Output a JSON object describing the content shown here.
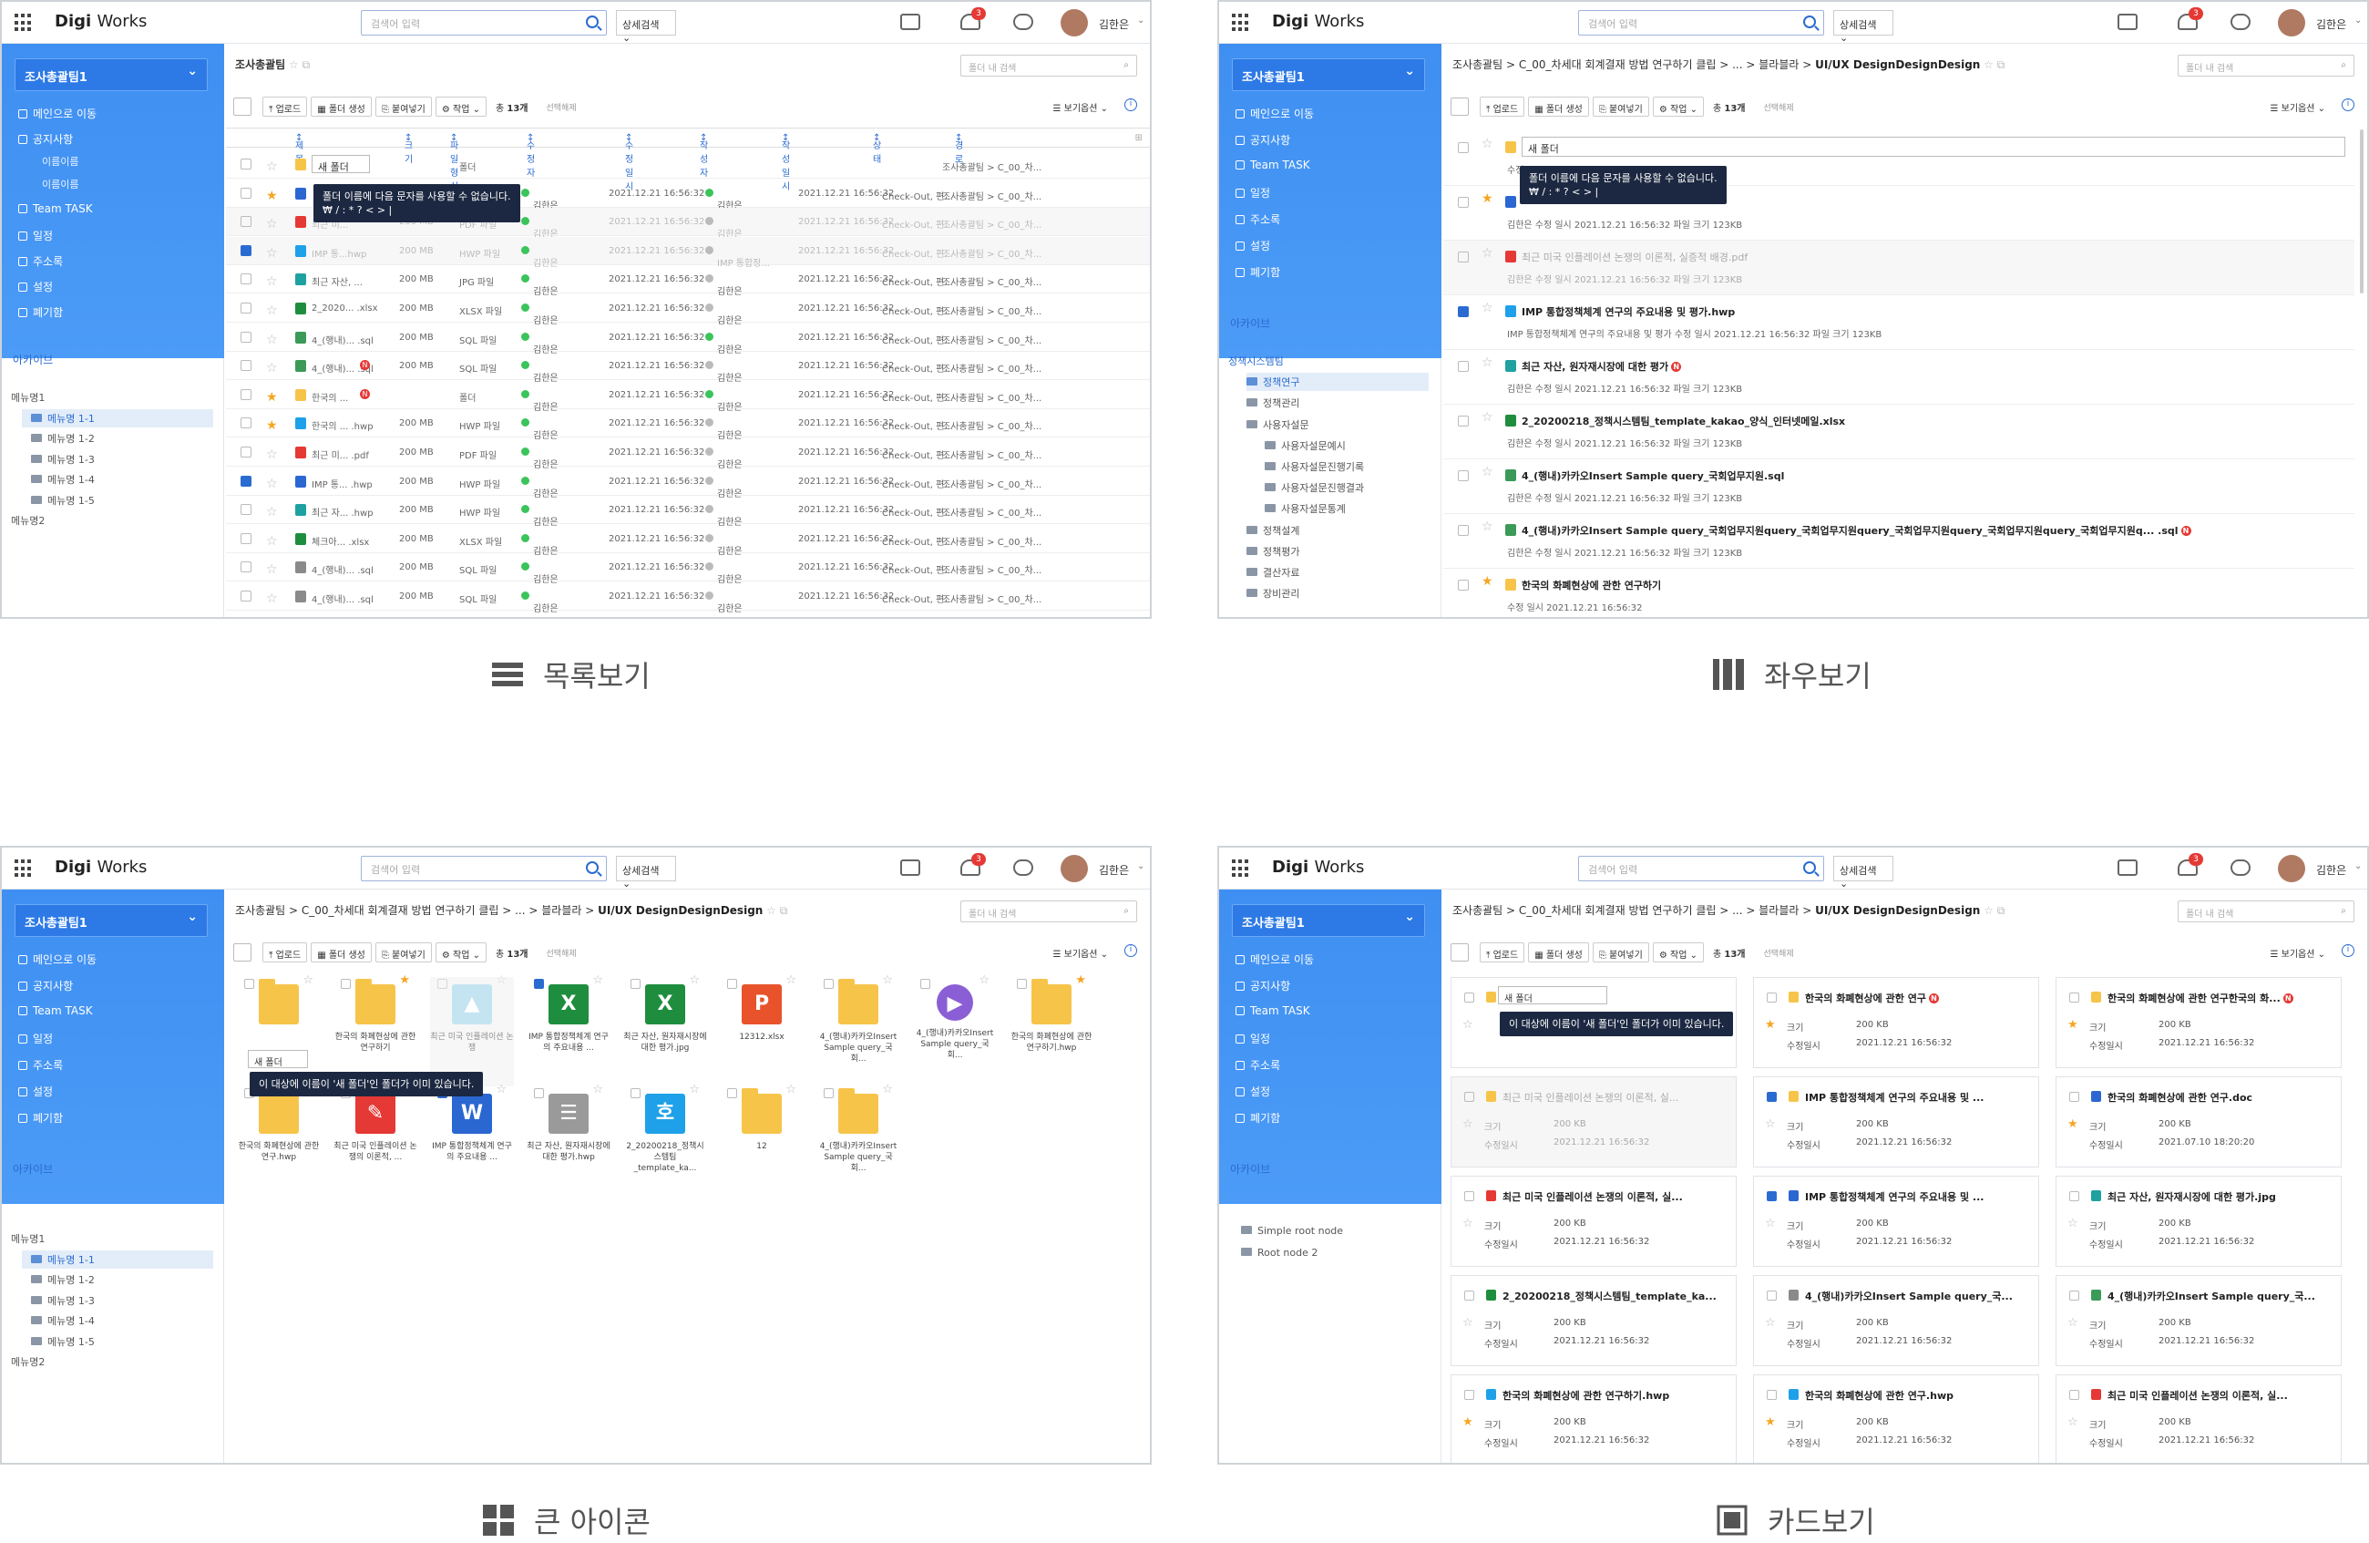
{
  "app": {
    "logo_bold": "Digi",
    "logo_rest": "Works",
    "search_placeholder": "검색어 입력",
    "adv_search": "상세검색",
    "badge": "3",
    "user": "김한은"
  },
  "sidebar": {
    "team": "조사총괄팀1",
    "nav": [
      "메인으로 이동",
      "공지사항",
      "Team TASK",
      "일정",
      "주소록",
      "설정",
      "폐기함"
    ],
    "notice_sub": [
      "이름이름",
      "이름이름"
    ],
    "archive": "아카이브"
  },
  "tree_menu": [
    "메뉴명1",
    "메뉴명 1-1",
    "메뉴명 1-2",
    "메뉴명 1-3",
    "메뉴명 1-4",
    "메뉴명 1-5",
    "메뉴명2"
  ],
  "tree_policy": [
    "정책시스템팀",
    "정책연구",
    "정책관리",
    "사용자설문",
    "사용자설문예시",
    "사용자설문진행기록",
    "사용자설문진행결과",
    "사용자설문통계",
    "정책설계",
    "정책평가",
    "결산자료",
    "장비관리"
  ],
  "tree_root": [
    "Simple root node",
    "Root node 2"
  ],
  "toolbar": {
    "upload": "업로드",
    "new_folder": "폴더 생성",
    "paste": "붙여넣기",
    "work": "작업",
    "count_prefix": "총",
    "count": "13개",
    "selected": "선택해제",
    "view_opt": "보기옵션",
    "folder_search": "폴더 내 검색"
  },
  "bc_short": "조사총괄팀",
  "bc_long": [
    "조사총괄팀",
    "C_00_차세대 회계결재 방법 연구하기 클립",
    "...",
    "블라블라",
    "UI/UX DesignDesignDesign"
  ],
  "list_view": {
    "headers": [
      "제목",
      "크기",
      "파일 형식",
      "수정자",
      "수정 일시",
      "작성자",
      "작성 일시",
      "상태",
      "경로"
    ],
    "new_folder_value": "새 폴더",
    "tooltip": [
      "폴더 이름에 다음 문자를 사용할 수 없습니다.",
      "₩ / : * ? < > |"
    ],
    "rows": [
      {
        "name": "",
        "size": "",
        "type": "폴더",
        "mod": "",
        "date": "",
        "author": "",
        "cdate": "",
        "state": "",
        "path": "조사총괄팀 > C_00_차...",
        "icon": "folder",
        "star": false,
        "cb": false,
        "dim": false,
        "gray": false
      },
      {
        "name": "",
        "size": "",
        "type": "",
        "mod": "김한은",
        "date": "2021.12.21 16:56:32",
        "author": "김한은",
        "cdate": "2021.12.21 16:56:32",
        "state": "Check-Out, 편...",
        "path": "조사총괄팀 > C_00_차...",
        "icon": "word",
        "star": true,
        "cb": false,
        "dim": false,
        "gray": false
      },
      {
        "name": "최근 미...",
        "size": "200 MB",
        "type": "PDF 파일",
        "mod": "김한은",
        "date": "2021.12.21 16:56:32",
        "author": "김한은",
        "cdate": "2021.12.21 16:56:32",
        "state": "Check-Out, 편...",
        "path": "조사총괄팀 > C_00_차...",
        "icon": "pdf",
        "star": false,
        "cb": false,
        "dim": true,
        "gray": true
      },
      {
        "name": "IMP 통...hwp",
        "size": "200 MB",
        "type": "HWP 파일",
        "mod": "김한은",
        "date": "2021.12.21 16:56:32",
        "author": "IMP 통합정...",
        "cdate": "2021.12.21 16:56:32",
        "state": "Check-Out, 편...",
        "path": "조사총괄팀 > C_00_차...",
        "icon": "hwp",
        "star": false,
        "cb": true,
        "dim": true,
        "gray": true
      },
      {
        "name": "최근 자산, ...",
        "size": "200 MB",
        "type": "JPG 파일",
        "mod": "김한은",
        "date": "2021.12.21 16:56:32",
        "author": "김한은",
        "cdate": "2021.12.21 16:56:32",
        "state": "Check-Out, 편...",
        "path": "조사총괄팀 > C_00_차...",
        "icon": "jpg",
        "star": false,
        "cb": false,
        "dim": false,
        "gray": true
      },
      {
        "name": "2_2020... .xlsx",
        "size": "200 MB",
        "type": "XLSX 파일",
        "mod": "김한은",
        "date": "2021.12.21 16:56:32",
        "author": "김한은",
        "cdate": "2021.12.21 16:56:32",
        "state": "Check-Out, 편...",
        "path": "조사총괄팀 > C_00_차...",
        "icon": "xlsx",
        "star": false,
        "cb": false,
        "dim": false,
        "gray": true
      },
      {
        "name": "4_(행내)... .sql",
        "size": "200 MB",
        "type": "SQL 파일",
        "mod": "김한은",
        "date": "2021.12.21 16:56:32",
        "author": "김한은",
        "cdate": "2021.12.21 16:56:32",
        "state": "Check-Out, 편...",
        "path": "조사총괄팀 > C_00_차...",
        "icon": "sql",
        "star": false,
        "cb": false,
        "dim": false,
        "gray": false
      },
      {
        "name": "4_(행내)... .sql",
        "size": "200 MB",
        "type": "SQL 파일",
        "mod": "김한은",
        "date": "2021.12.21 16:56:32",
        "author": "김한은",
        "cdate": "2021.12.21 16:56:32",
        "state": "Check-Out, 편...",
        "path": "조사총괄팀 > C_00_차...",
        "icon": "sql",
        "star": false,
        "cb": false,
        "dim": false,
        "gray": true,
        "n": true
      },
      {
        "name": "한국의 ...",
        "size": "",
        "type": "폴더",
        "mod": "김한은",
        "date": "2021.12.21 16:56:32",
        "author": "김한은",
        "cdate": "2021.12.21 16:56:32",
        "state": "Check-Out, 편...",
        "path": "조사총괄팀 > C_00_차...",
        "icon": "folder",
        "star": true,
        "cb": false,
        "dim": false,
        "gray": false,
        "n": true
      },
      {
        "name": "한국의 ... .hwp",
        "size": "200 MB",
        "type": "HWP 파일",
        "mod": "김한은",
        "date": "2021.12.21 16:56:32",
        "author": "김한은",
        "cdate": "2021.12.21 16:56:32",
        "state": "Check-Out, 편...",
        "path": "조사총괄팀 > C_00_차...",
        "icon": "hwp",
        "star": true,
        "cb": false,
        "dim": false,
        "gray": true
      },
      {
        "name": "최근 미... .pdf",
        "size": "200 MB",
        "type": "PDF 파일",
        "mod": "김한은",
        "date": "2021.12.21 16:56:32",
        "author": "김한은",
        "cdate": "2021.12.21 16:56:32",
        "state": "Check-Out, 편...",
        "path": "조사총괄팀 > C_00_차...",
        "icon": "pdf",
        "star": false,
        "cb": false,
        "dim": false,
        "gray": true
      },
      {
        "name": "IMP 통... .hwp",
        "size": "200 MB",
        "type": "HWP 파일",
        "mod": "김한은",
        "date": "2021.12.21 16:56:32",
        "author": "김한은",
        "cdate": "2021.12.21 16:56:32",
        "state": "Check-Out, 편...",
        "path": "조사총괄팀 > C_00_차...",
        "icon": "word",
        "star": false,
        "cb": true,
        "dim": false,
        "gray": true
      },
      {
        "name": "최근 자... .hwp",
        "size": "200 MB",
        "type": "HWP 파일",
        "mod": "김한은",
        "date": "2021.12.21 16:56:32",
        "author": "김한은",
        "cdate": "2021.12.21 16:56:32",
        "state": "Check-Out, 편...",
        "path": "조사총괄팀 > C_00_차...",
        "icon": "jpg",
        "star": false,
        "cb": false,
        "dim": false,
        "gray": true
      },
      {
        "name": "체크아... .xlsx",
        "size": "200 MB",
        "type": "XLSX 파일",
        "mod": "김한은",
        "date": "2021.12.21 16:56:32",
        "author": "김한은",
        "cdate": "2021.12.21 16:56:32",
        "state": "Check-Out, 편...",
        "path": "조사총괄팀 > C_00_차...",
        "icon": "xlsx",
        "star": false,
        "cb": false,
        "dim": false,
        "gray": true
      },
      {
        "name": "4_(행내)... .sql",
        "size": "200 MB",
        "type": "SQL 파일",
        "mod": "김한은",
        "date": "2021.12.21 16:56:32",
        "author": "김한은",
        "cdate": "2021.12.21 16:56:32",
        "state": "Check-Out, 편...",
        "path": "조사총괄팀 > C_00_차...",
        "icon": "sqlg",
        "star": false,
        "cb": false,
        "dim": false,
        "gray": true
      },
      {
        "name": "4_(행내)... .sql",
        "size": "200 MB",
        "type": "SQL 파일",
        "mod": "김한은",
        "date": "2021.12.21 16:56:32",
        "author": "김한은",
        "cdate": "2021.12.21 16:56:32",
        "state": "Check-Out, 편...",
        "path": "조사총괄팀 > C_00_차...",
        "icon": "sqlg",
        "star": false,
        "cb": false,
        "dim": false,
        "gray": true
      }
    ]
  },
  "lr_view": {
    "new_folder_value": "새 폴더",
    "tooltip": [
      "폴더 이름에 다음 문자를 사용할 수 없습니다.",
      "₩ / : * ? < > |"
    ],
    "rows": [
      {
        "name": "",
        "meta": "수정",
        "icon": "folder",
        "star": false,
        "cb": false,
        "dim": false
      },
      {
        "name": "",
        "meta": "김한은    수정 일시 2021.12.21 16:56:32    파일 크기 123KB",
        "icon": "word",
        "star": true,
        "cb": false,
        "dim": false
      },
      {
        "name": "최근 미국 인플레이션 논쟁의 이론적, 실증적 배경.pdf",
        "meta": "김한은    수정 일시 2021.12.21 16:56:32    파일 크기 123KB",
        "icon": "pdf",
        "star": false,
        "cb": false,
        "dim": true
      },
      {
        "name": "IMP 통합정책체계 연구의 주요내용 및 평가.hwp",
        "meta": "IMP 통합정책체계 연구의 주요내용 및 평가    수정 일시 2021.12.21 16:56:32    파일 크기 123KB",
        "icon": "hwp",
        "star": false,
        "cb": true,
        "dim": false
      },
      {
        "name": "최근 자산, 원자재시장에 대한 평가",
        "meta": "김한은    수정 일시 2021.12.21 16:56:32    파일 크기 123KB",
        "icon": "jpg",
        "star": false,
        "cb": false,
        "dim": false,
        "n": true
      },
      {
        "name": "2_20200218_정책시스템팀_template_kakao_양식_인터넷메일.xlsx",
        "meta": "김한은    수정 일시 2021.12.21 16:56:32    파일 크기 123KB",
        "icon": "xlsx",
        "star": false,
        "cb": false,
        "dim": false
      },
      {
        "name": "4_(행내)카카오Insert Sample query_국회업무지원.sql",
        "meta": "김한은    수정 일시 2021.12.21 16:56:32    파일 크기 123KB",
        "icon": "sql",
        "star": false,
        "cb": false,
        "dim": false
      },
      {
        "name": "4_(행내)카카오Insert Sample query_국회업무지원query_국회업무지원query_국회업무지원query_국회업무지원query_국회업무지원q... .sql",
        "meta": "김한은    수정 일시 2021.12.21 16:56:32    파일 크기 123KB",
        "icon": "sql",
        "star": false,
        "cb": false,
        "dim": false,
        "n": true
      },
      {
        "name": "한국의 화폐현상에 관한 연구하기",
        "meta": "수정 일시 2021.12.21 16:56:32",
        "icon": "folder",
        "star": true,
        "cb": false,
        "dim": false
      }
    ]
  },
  "big_view": {
    "new_folder_value": "새 폴더",
    "tooltip": "이 대상에 이름이 '새 폴더'인 폴더가 이미 있습니다.",
    "items": [
      {
        "label": "",
        "icon": "folder",
        "star": false,
        "cb": false
      },
      {
        "label": "한국의 화폐현상에 관한 연구하기",
        "icon": "folder2",
        "star": true,
        "cb": false
      },
      {
        "label": "최근 미국 인플레이션 논쟁",
        "icon": "img",
        "star": false,
        "cb": false,
        "dim": true
      },
      {
        "label": "IMP 통합정책체계 연구의 주요내용 ...",
        "icon": "X",
        "star": false,
        "cb": true
      },
      {
        "label": "최근 자산, 원자재시장에 대한 평가.jpg",
        "icon": "X",
        "star": false,
        "cb": false
      },
      {
        "label": "12312.xlsx",
        "icon": "P",
        "star": false,
        "cb": false
      },
      {
        "label": "4_(행내)카카오Insert Sample query_국회...",
        "icon": "folder2",
        "star": false,
        "cb": false
      },
      {
        "label": "4_(행내)카카오Insert Sample query_국회...",
        "icon": "play",
        "star": false,
        "cb": false
      },
      {
        "label": "한국의 화폐현상에 관한 연구하기.hwp",
        "icon": "zip",
        "star": true,
        "cb": false
      },
      {
        "label": "한국의 화폐현상에 관한 연구.hwp",
        "icon": "folder",
        "star": true,
        "cb": false
      },
      {
        "label": "최근 미국 인플레이션 논쟁의 이론적, ...",
        "icon": "pdfbig",
        "star": false,
        "cb": false
      },
      {
        "label": "IMP 통합정책체계 연구의 주요내용 ...",
        "icon": "W",
        "star": false,
        "cb": true
      },
      {
        "label": "최근 자산, 원자재시장에 대한 평가.hwp",
        "icon": "doc",
        "star": false,
        "cb": false
      },
      {
        "label": "2_20200218_정책시스템팀_template_ka...",
        "icon": "hwpbig",
        "star": false,
        "cb": false
      },
      {
        "label": "12",
        "icon": "folder",
        "star": false,
        "cb": false
      },
      {
        "label": "4_(행내)카카오Insert Sample query_국회...",
        "icon": "folder",
        "star": false,
        "cb": false
      }
    ]
  },
  "card_view": {
    "new_folder_value": "새 폴더",
    "tooltip": "이 대상에 이름이 '새 폴더'인 폴더가 이미 있습니다.",
    "k_size": "크기",
    "k_date": "수정일시",
    "cards": [
      {
        "title": "",
        "size": "",
        "date": "",
        "icon": "folder",
        "star": false,
        "cb": false
      },
      {
        "title": "한국의 화폐현상에 관한 연구",
        "size": "200 KB",
        "date": "2021.12.21 16:56:32",
        "icon": "folder",
        "star": true,
        "cb": false,
        "n": true
      },
      {
        "title": "한국의 화폐현상에 관한 연구한국의 화...",
        "size": "200 KB",
        "date": "2021.12.21 16:56:32",
        "icon": "folder",
        "star": true,
        "cb": false,
        "n": true
      },
      {
        "title": "최근 미국 인플레이션 논쟁의 이론적, 실...",
        "size": "200 KB",
        "date": "2021.12.21 16:56:32",
        "icon": "folder",
        "star": false,
        "cb": false,
        "dim": true
      },
      {
        "title": "IMP 통합정책체계 연구의 주요내용 및 ...",
        "size": "200 KB",
        "date": "2021.12.21 16:56:32",
        "icon": "folder",
        "star": false,
        "cb": true
      },
      {
        "title": "한국의 화폐현상에 관한 연구.doc",
        "size": "200 KB",
        "date": "2021.07.10 18:20:20",
        "icon": "word",
        "star": true,
        "cb": false
      },
      {
        "title": "최근 미국 인플레이션 논쟁의 이론적, 실...",
        "size": "200 KB",
        "date": "2021.12.21 16:56:32",
        "icon": "pdf",
        "star": false,
        "cb": false
      },
      {
        "title": "IMP 통합정책체계 연구의 주요내용 및 ...",
        "size": "200 KB",
        "date": "2021.12.21 16:56:32",
        "icon": "word",
        "star": false,
        "cb": true
      },
      {
        "title": "최근 자산, 원자재시장에 대한 평가.jpg",
        "size": "200 KB",
        "date": "2021.12.21 16:56:32",
        "icon": "jpg",
        "star": false,
        "cb": false
      },
      {
        "title": "2_20200218_정책시스템팀_template_ka...",
        "size": "200 KB",
        "date": "2021.12.21 16:56:32",
        "icon": "xlsx",
        "star": false,
        "cb": false
      },
      {
        "title": "4_(행내)카카오Insert Sample query_국...",
        "size": "200 KB",
        "date": "2021.12.21 16:56:32",
        "icon": "sqlg",
        "star": false,
        "cb": false
      },
      {
        "title": "4_(행내)카카오Insert Sample query_국...",
        "size": "200 KB",
        "date": "2021.12.21 16:56:32",
        "icon": "sql",
        "star": false,
        "cb": false
      },
      {
        "title": "한국의 화폐현상에 관한 연구하기.hwp",
        "size": "200 KB",
        "date": "2021.12.21 16:56:32",
        "icon": "hwp",
        "star": true,
        "cb": false
      },
      {
        "title": "한국의 화폐현상에 관한 연구.hwp",
        "size": "200 KB",
        "date": "2021.12.21 16:56:32",
        "icon": "hwp",
        "star": true,
        "cb": false
      },
      {
        "title": "최근 미국 인플레이션 논쟁의 이론적, 실...",
        "size": "200 KB",
        "date": "2021.12.21 16:56:32",
        "icon": "pdf",
        "star": false,
        "cb": false
      }
    ]
  },
  "captions": {
    "list": "목록보기",
    "lr": "좌우보기",
    "big": "큰 아이콘",
    "card": "카드보기"
  },
  "colors": {
    "accent": "#2a6bd1",
    "sidebar": "#3f8ff2",
    "folder": "#f7c44a",
    "pdf": "#e53935",
    "xlsx": "#1e8e3e",
    "hwp": "#1ea1e8",
    "word": "#2b67d1",
    "tooltip": "#1c2841"
  }
}
